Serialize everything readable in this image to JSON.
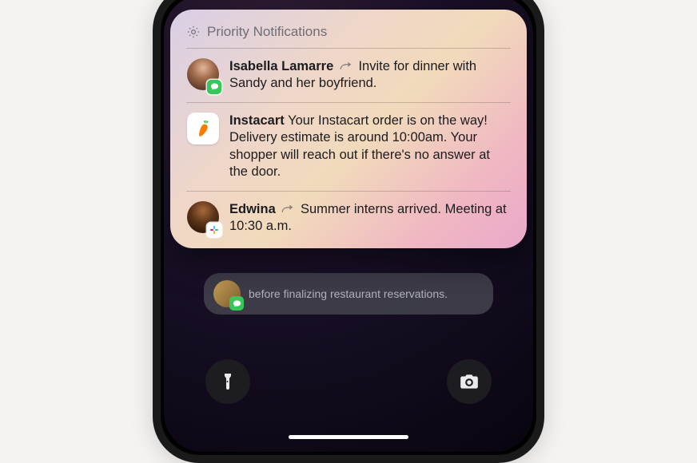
{
  "header": {
    "title": "Priority Notifications"
  },
  "notifications": [
    {
      "sender": "Isabella Lamarre",
      "body": "Invite for dinner with Sandy and her boyfriend.",
      "has_reply_icon": true,
      "badge": "messages"
    },
    {
      "sender": "Instacart",
      "body": "Your Instacart order is on the way! Delivery estimate is around 10:00am. Your shopper will reach out if there's no answer at the door.",
      "has_reply_icon": false,
      "badge": "none"
    },
    {
      "sender": "Edwina",
      "body": "Summer interns arrived. Meeting at 10:30 a.m.",
      "has_reply_icon": true,
      "badge": "slack"
    }
  ],
  "background_notification": {
    "body": "before finalizing restaurant reservations."
  },
  "icons": {
    "gear": "gear-icon",
    "flashlight": "flashlight-icon",
    "camera": "camera-icon",
    "carrot": "carrot-icon",
    "messages": "messages-icon",
    "slack": "slack-icon"
  }
}
